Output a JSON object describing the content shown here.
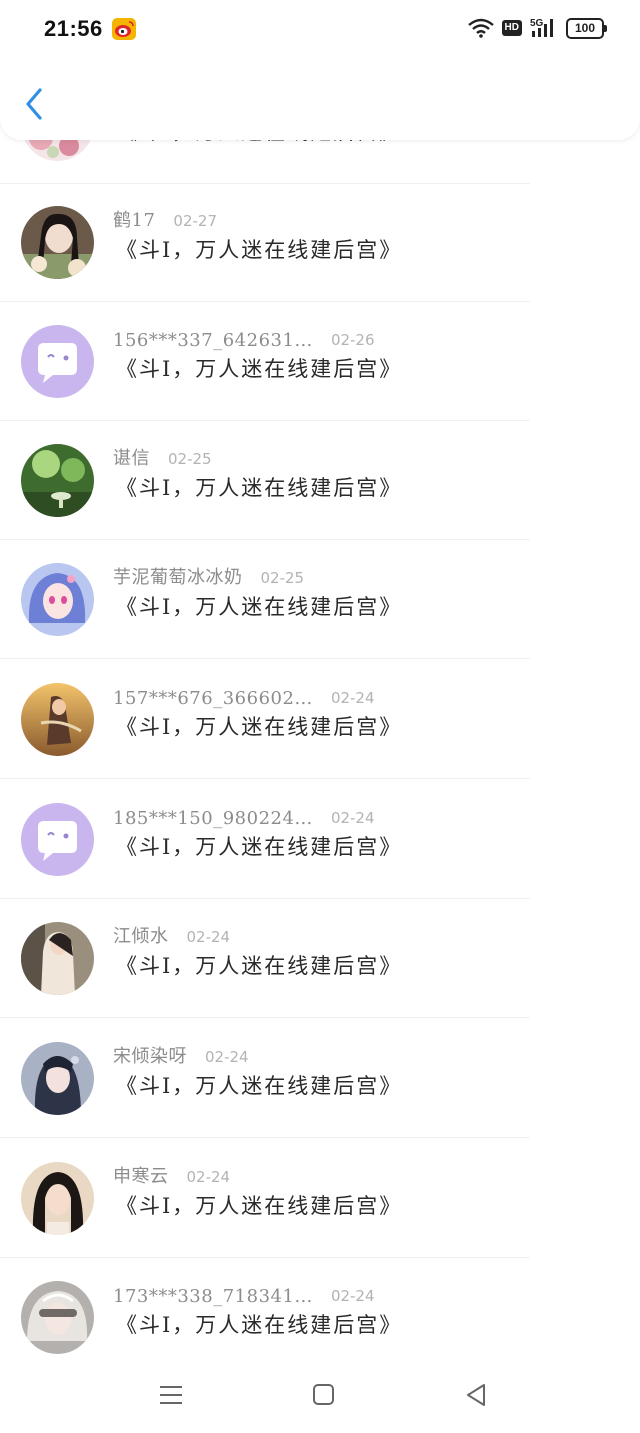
{
  "status_bar": {
    "time": "21:56",
    "network": "5G",
    "hd": "HD",
    "battery": "100"
  },
  "header": {
    "back_icon": "chevron-left-icon"
  },
  "colors": {
    "accent": "#2f8fe6",
    "secondary_text": "#8c8c8c",
    "date_text": "#b3b3b3",
    "default_avatar_bg": "#c9b6ee"
  },
  "comments": [
    {
      "username": "",
      "date": "",
      "message": "《斗I，万人迷在线建后宫》",
      "avatar": "pink-floral-avatar"
    },
    {
      "username": "鹤17",
      "date": "02-27",
      "message": "《斗I，万人迷在线建后宫》",
      "avatar": "girl-flowers-avatar"
    },
    {
      "username": "156***337_642631…",
      "date": "02-26",
      "message": "《斗I，万人迷在线建后宫》",
      "avatar": "default-chat-avatar"
    },
    {
      "username": "谌信",
      "date": "02-25",
      "message": "《斗I，万人迷在线建后宫》",
      "avatar": "green-scene-avatar"
    },
    {
      "username": "芋泥葡萄冰冰奶",
      "date": "02-25",
      "message": "《斗I，万人迷在线建后宫》",
      "avatar": "anime-girl-avatar"
    },
    {
      "username": "157***676_366602…",
      "date": "02-24",
      "message": "《斗I，万人迷在线建后宫》",
      "avatar": "sunset-figure-avatar"
    },
    {
      "username": "185***150_980224…",
      "date": "02-24",
      "message": "《斗I，万人迷在线建后宫》",
      "avatar": "default-chat-avatar"
    },
    {
      "username": "江倾水",
      "date": "02-24",
      "message": "《斗I，万人迷在线建后宫》",
      "avatar": "girl-white-avatar"
    },
    {
      "username": "宋倾染呀",
      "date": "02-24",
      "message": "《斗I，万人迷在线建后宫》",
      "avatar": "ancient-lady-avatar"
    },
    {
      "username": "申寒云",
      "date": "02-24",
      "message": "《斗I，万人迷在线建后宫》",
      "avatar": "girl-portrait-avatar"
    },
    {
      "username": "173***338_718341…",
      "date": "02-24",
      "message": "《斗I，万人迷在线建后宫》",
      "avatar": "silver-hair-avatar"
    }
  ],
  "nav_bar": {
    "menu_icon": "menu-icon",
    "home_icon": "home-square-icon",
    "back_icon": "back-triangle-icon"
  }
}
